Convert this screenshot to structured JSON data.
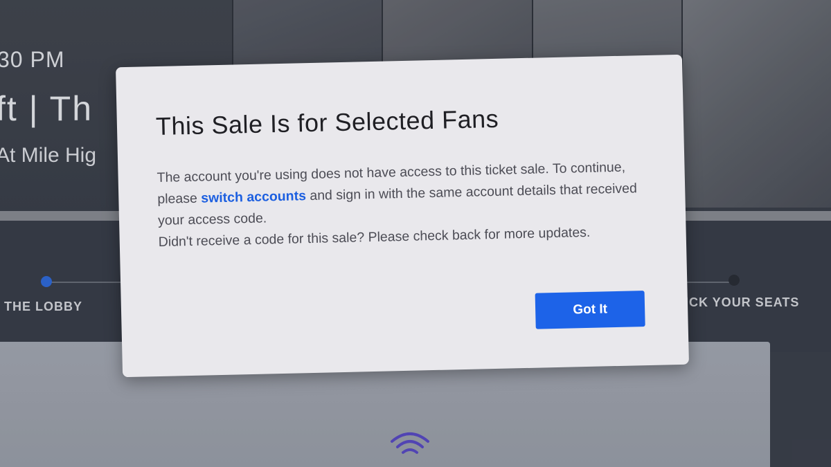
{
  "event": {
    "time": "30 PM",
    "title": "ft | Th",
    "venue": "At Mile Hig"
  },
  "steps": [
    {
      "label": "THE LOBBY",
      "active": true
    },
    {
      "label": "PICK YOUR SEATS",
      "active": false
    }
  ],
  "modal": {
    "title": "This Sale Is for Selected Fans",
    "body_part1": "The account you're using does not have access to this ticket sale. To continue, please ",
    "body_link": "switch accounts",
    "body_part2": " and sign in with the same account details that received your access code.",
    "body_line2": "Didn't receive a code for this sale? Please check back for more updates.",
    "button_label": "Got It"
  },
  "colors": {
    "accent": "#1d63e8",
    "link": "#1c5fe0",
    "active_step": "#2f6bdf",
    "inactive_step": "#2a2d35",
    "wifi_icon": "#5a4ac8"
  },
  "icons": {
    "loading": "wifi-icon"
  }
}
